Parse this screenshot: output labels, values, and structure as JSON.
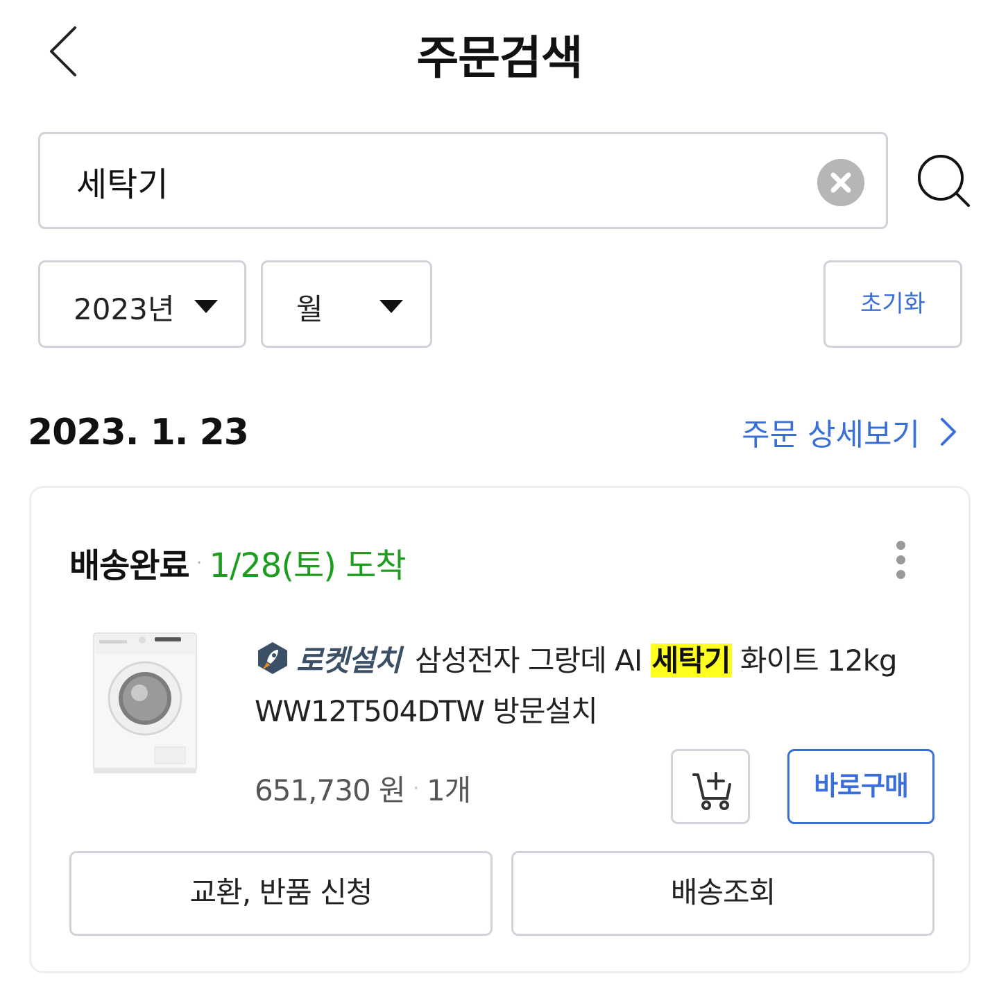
{
  "header": {
    "title": "주문검색",
    "back_icon": "chevron-left-icon"
  },
  "search": {
    "value": "세탁기",
    "clear_icon": "close-circle-icon",
    "search_icon": "search-icon"
  },
  "filters": {
    "year_selected": "2023년",
    "month_selected": "월",
    "reset_label": "초기화"
  },
  "order": {
    "date": "2023. 1. 23",
    "detail_link_label": "주문 상세보기",
    "status": "배송완료",
    "status_separator": "·",
    "arrival": "1/28(토) 도착",
    "item": {
      "badge_label": "로켓설치",
      "name_before": "삼성전자 그랑데 AI",
      "name_highlight": "세탁기",
      "name_after": "화이트 12kg WW12T504DTW 방문설치",
      "price": "651,730 원",
      "separator": "·",
      "quantity": "1개",
      "image_icon": "washing-machine-image"
    },
    "buy_now_label": "바로구매",
    "cart_icon": "add-to-cart-icon",
    "exchange_label": "교환, 반품 신청",
    "tracking_label": "배송조회",
    "more_icon": "more-vertical-icon"
  },
  "colors": {
    "accent": "#3a6fd8",
    "arrival_green": "#1e9e1e",
    "highlight": "#ffff1f",
    "border": "#cfd3d9"
  }
}
